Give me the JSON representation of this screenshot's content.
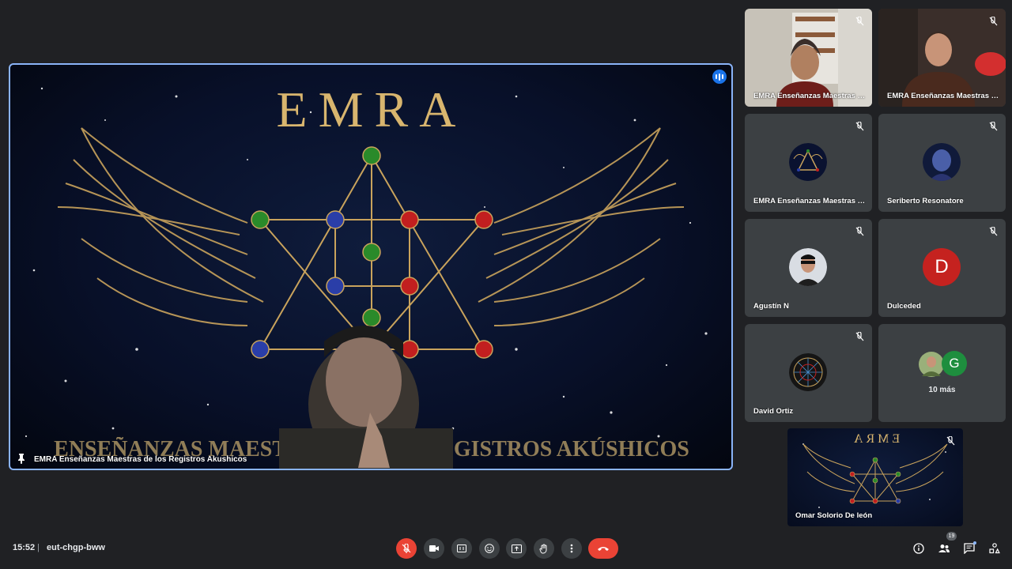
{
  "main_video": {
    "presenter_name": "EMRA Enseñanzas Maestras de los Registros Akushicos",
    "logo_title": "EMRA",
    "banner_text": "ENSEÑANZAS MAESTRAS DE LOS REGISTROS AKÚSHICOS"
  },
  "participants": [
    {
      "name": "EMRA Enseñanzas Maestras d...",
      "type": "video"
    },
    {
      "name": "EMRA Enseñanzas Maestras d...",
      "type": "video"
    },
    {
      "name": "EMRA Enseñanzas Maestras d...",
      "type": "avatar-image"
    },
    {
      "name": "Seriberto Resonatore",
      "type": "avatar-image"
    },
    {
      "name": "Agustín N",
      "type": "avatar-image"
    },
    {
      "name": "Dulceded",
      "type": "avatar-letter",
      "letter": "D"
    },
    {
      "name": "David Ortiz",
      "type": "avatar-image"
    }
  ],
  "overflow_tile": {
    "label": "10 más",
    "letter": "G"
  },
  "self_view": {
    "name": "Omar Solorio De león",
    "logo_title": "EMRA"
  },
  "bottom_bar": {
    "time": "15:52",
    "separator": "|",
    "meeting_code": "eut-chgp-bww",
    "controls": [
      "mic-off-icon",
      "camera-icon",
      "captions-icon",
      "emoji-icon",
      "present-icon",
      "raise-hand-icon",
      "more-options-icon",
      "end-call-icon"
    ],
    "participants_count": "19"
  },
  "colors": {
    "accent_blue": "#8ab4f8",
    "end_red": "#ea4335",
    "tile_bg": "#3c4043",
    "page_bg": "#202124"
  }
}
